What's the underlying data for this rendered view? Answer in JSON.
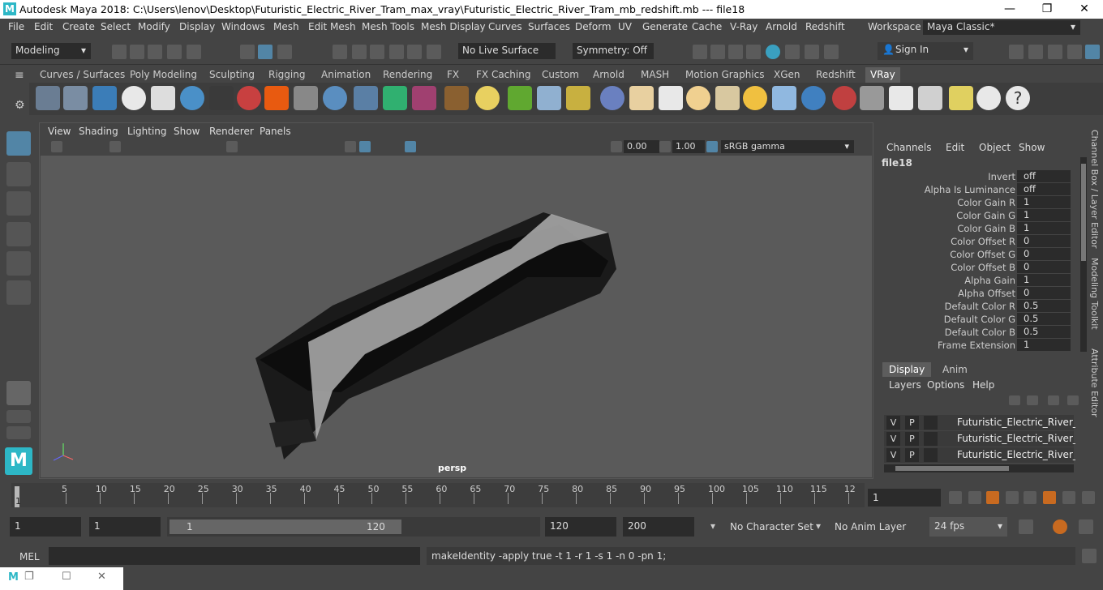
{
  "window": {
    "title": "Autodesk Maya 2018: C:\\Users\\lenov\\Desktop\\Futuristic_Electric_River_Tram_max_vray\\Futuristic_Electric_River_Tram_mb_redshift.mb   ---   file18",
    "minimize": "—",
    "maximize": "❐",
    "close": "✕"
  },
  "menu": [
    "File",
    "Edit",
    "Create",
    "Select",
    "Modify",
    "Display",
    "Windows",
    "Mesh",
    "Edit Mesh",
    "Mesh Tools",
    "Mesh Display",
    "Curves",
    "Surfaces",
    "Deform",
    "UV",
    "Generate",
    "Cache",
    "V-Ray",
    "Arnold",
    "Redshift"
  ],
  "workspace": {
    "label": "Workspace :",
    "value": "Maya Classic*"
  },
  "status": {
    "mode": "Modeling",
    "live_surface": "No Live Surface",
    "symmetry": "Symmetry: Off",
    "sign_in": "Sign In"
  },
  "shelf_tabs": [
    "Curves / Surfaces",
    "Poly Modeling",
    "Sculpting",
    "Rigging",
    "Animation",
    "Rendering",
    "FX",
    "FX Caching",
    "Custom",
    "Arnold",
    "MASH",
    "Motion Graphics",
    "XGen",
    "Redshift",
    "VRay"
  ],
  "active_shelf_tab": "VRay",
  "viewport": {
    "menus": [
      "View",
      "Shading",
      "Lighting",
      "Show",
      "Renderer",
      "Panels"
    ],
    "exposure": "0.00",
    "gamma": "1.00",
    "color_space": "sRGB gamma",
    "camera_label": "persp"
  },
  "channel_box": {
    "menus": [
      "Channels",
      "Edit",
      "Object",
      "Show"
    ],
    "node": "file18",
    "attrs": [
      {
        "label": "Invert",
        "value": "off"
      },
      {
        "label": "Alpha Is Luminance",
        "value": "off"
      },
      {
        "label": "Color Gain R",
        "value": "1"
      },
      {
        "label": "Color Gain G",
        "value": "1"
      },
      {
        "label": "Color Gain B",
        "value": "1"
      },
      {
        "label": "Color Offset R",
        "value": "0"
      },
      {
        "label": "Color Offset G",
        "value": "0"
      },
      {
        "label": "Color Offset B",
        "value": "0"
      },
      {
        "label": "Alpha Gain",
        "value": "1"
      },
      {
        "label": "Alpha Offset",
        "value": "0"
      },
      {
        "label": "Default Color R",
        "value": "0.5"
      },
      {
        "label": "Default Color G",
        "value": "0.5"
      },
      {
        "label": "Default Color B",
        "value": "0.5"
      },
      {
        "label": "Frame Extension",
        "value": "1"
      }
    ]
  },
  "side_tabs": [
    "Channel Box / Layer Editor",
    "Modeling Toolkit",
    "Attribute Editor"
  ],
  "layer_editor": {
    "tabs": [
      "Display",
      "Anim"
    ],
    "menus": [
      "Layers",
      "Options",
      "Help"
    ],
    "layers": [
      {
        "v": "V",
        "p": "P",
        "name": "Futuristic_Electric_River_Tram"
      },
      {
        "v": "V",
        "p": "P",
        "name": "Futuristic_Electric_River_Tram"
      },
      {
        "v": "V",
        "p": "P",
        "name": "Futuristic_Electric_River_Tram"
      }
    ]
  },
  "timeline": {
    "ticks": [
      "5",
      "10",
      "15",
      "20",
      "25",
      "30",
      "35",
      "40",
      "45",
      "50",
      "55",
      "60",
      "65",
      "70",
      "75",
      "80",
      "85",
      "90",
      "95",
      "100",
      "105",
      "110",
      "115",
      "12"
    ],
    "current_marker": "1",
    "current_frame": "1"
  },
  "range": {
    "start": "1",
    "playback_start": "1",
    "slider_start": "1",
    "slider_end": "120",
    "playback_end": "120",
    "end": "200",
    "character_set": "No Character Set",
    "anim_layer": "No Anim Layer",
    "fps": "24 fps"
  },
  "command": {
    "lang": "MEL",
    "input": "",
    "output": "makeIdentity -apply true -t 1 -r 1 -s 1 -n 0 -pn 1;"
  },
  "colors": {
    "accent": "#5285a6",
    "background": "#444444",
    "viewport": "#5a5a5a"
  }
}
